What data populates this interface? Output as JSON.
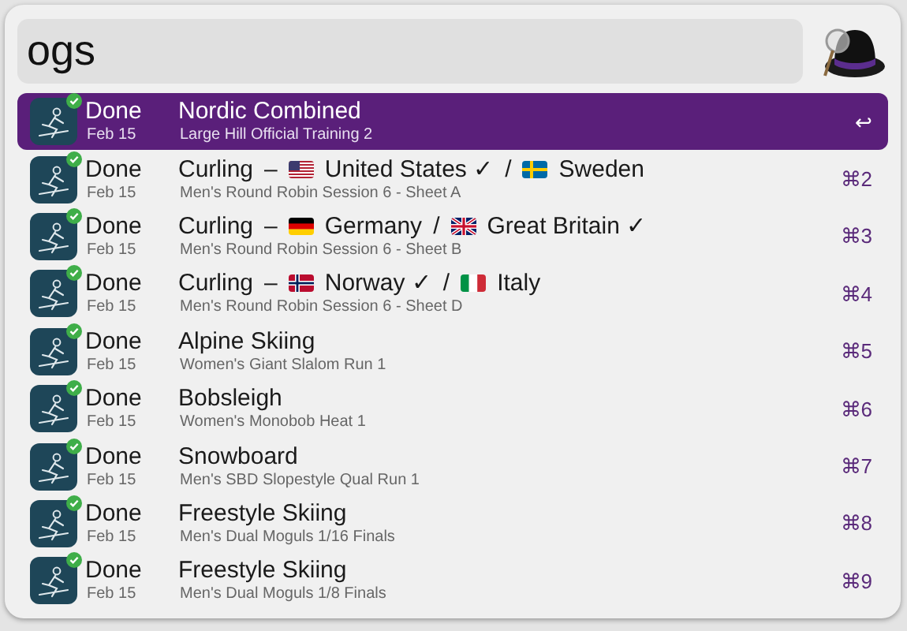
{
  "search": {
    "value": "ogs"
  },
  "results": [
    {
      "selected": true,
      "status": "Done",
      "date": "Feb 15",
      "title": [
        {
          "kind": "text",
          "text": "Nordic Combined"
        }
      ],
      "subtitle": "Large Hill Official Training 2",
      "shortcut": "↩"
    },
    {
      "selected": false,
      "status": "Done",
      "date": "Feb 15",
      "title": [
        {
          "kind": "text",
          "text": "Curling"
        },
        {
          "kind": "text",
          "text": "–"
        },
        {
          "kind": "flag_us"
        },
        {
          "kind": "text",
          "text": "United States ✓"
        },
        {
          "kind": "text",
          "text": "/"
        },
        {
          "kind": "flag_se"
        },
        {
          "kind": "text",
          "text": "Sweden"
        }
      ],
      "subtitle": "Men's Round Robin Session 6 - Sheet A",
      "shortcut": "⌘2"
    },
    {
      "selected": false,
      "status": "Done",
      "date": "Feb 15",
      "title": [
        {
          "kind": "text",
          "text": "Curling"
        },
        {
          "kind": "text",
          "text": "–"
        },
        {
          "kind": "flag_de"
        },
        {
          "kind": "text",
          "text": "Germany"
        },
        {
          "kind": "text",
          "text": "/"
        },
        {
          "kind": "flag_gb"
        },
        {
          "kind": "text",
          "text": "Great Britain ✓"
        }
      ],
      "subtitle": "Men's Round Robin Session 6 - Sheet B",
      "shortcut": "⌘3"
    },
    {
      "selected": false,
      "status": "Done",
      "date": "Feb 15",
      "title": [
        {
          "kind": "text",
          "text": "Curling"
        },
        {
          "kind": "text",
          "text": "–"
        },
        {
          "kind": "flag_no"
        },
        {
          "kind": "text",
          "text": "Norway ✓"
        },
        {
          "kind": "text",
          "text": "/"
        },
        {
          "kind": "flag_it"
        },
        {
          "kind": "text",
          "text": "Italy"
        }
      ],
      "subtitle": "Men's Round Robin Session 6 - Sheet D",
      "shortcut": "⌘4"
    },
    {
      "selected": false,
      "status": "Done",
      "date": "Feb 15",
      "title": [
        {
          "kind": "text",
          "text": "Alpine Skiing"
        }
      ],
      "subtitle": "Women's Giant Slalom Run 1",
      "shortcut": "⌘5"
    },
    {
      "selected": false,
      "status": "Done",
      "date": "Feb 15",
      "title": [
        {
          "kind": "text",
          "text": "Bobsleigh"
        }
      ],
      "subtitle": "Women's Monobob Heat 1",
      "shortcut": "⌘6"
    },
    {
      "selected": false,
      "status": "Done",
      "date": "Feb 15",
      "title": [
        {
          "kind": "text",
          "text": "Snowboard"
        }
      ],
      "subtitle": "Men's SBD Slopestyle Qual Run 1",
      "shortcut": "⌘7"
    },
    {
      "selected": false,
      "status": "Done",
      "date": "Feb 15",
      "title": [
        {
          "kind": "text",
          "text": "Freestyle Skiing"
        }
      ],
      "subtitle": "Men's Dual Moguls 1/16 Finals",
      "shortcut": "⌘8"
    },
    {
      "selected": false,
      "status": "Done",
      "date": "Feb 15",
      "title": [
        {
          "kind": "text",
          "text": "Freestyle Skiing"
        }
      ],
      "subtitle": "Men's Dual Moguls 1/8 Finals",
      "shortcut": "⌘9"
    }
  ]
}
